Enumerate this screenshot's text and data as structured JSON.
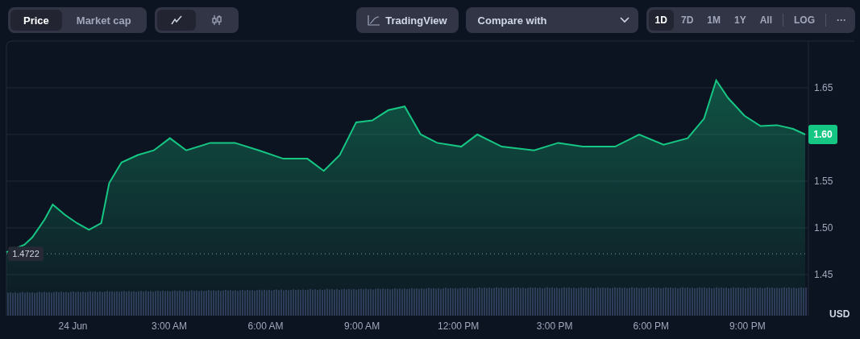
{
  "metric_tabs": [
    {
      "label": "Price",
      "selected": true
    },
    {
      "label": "Market cap",
      "selected": false
    }
  ],
  "style_tabs": [
    {
      "kind": "line",
      "selected": true
    },
    {
      "kind": "candles",
      "selected": false
    }
  ],
  "tradingview_button": "TradingView",
  "compare": {
    "placeholder": "Compare with"
  },
  "ranges": [
    {
      "label": "1D",
      "selected": true
    },
    {
      "label": "7D",
      "selected": false
    },
    {
      "label": "1M",
      "selected": false
    },
    {
      "label": "1Y",
      "selected": false
    },
    {
      "label": "All",
      "selected": false
    }
  ],
  "log_button": "LOG",
  "more_button": "···",
  "chart": {
    "start_price_label": "1.4722",
    "current_price_label": "1.60",
    "currency": "USD",
    "chart_data": {
      "type": "area",
      "x": [
        -2.07,
        -1.51,
        -1.26,
        -0.88,
        -0.63,
        -0.25,
        0.13,
        0.5,
        0.88,
        1.13,
        1.51,
        2.02,
        2.52,
        3.02,
        3.53,
        4.28,
        5.04,
        5.79,
        6.55,
        7.3,
        7.81,
        8.31,
        8.82,
        9.32,
        9.82,
        10.33,
        10.83,
        11.34,
        12.09,
        12.59,
        13.35,
        14.36,
        15.11,
        15.87,
        16.88,
        17.63,
        18.39,
        19.14,
        19.65,
        20.03,
        20.4,
        20.91,
        21.41,
        21.92,
        22.42,
        22.8
      ],
      "series": [
        {
          "color": "#16c784",
          "values": [
            1.474,
            1.482,
            1.49,
            1.509,
            1.525,
            1.514,
            1.505,
            1.498,
            1.505,
            1.548,
            1.57,
            1.578,
            1.583,
            1.596,
            1.583,
            1.591,
            1.591,
            1.583,
            1.574,
            1.574,
            1.561,
            1.578,
            1.613,
            1.615,
            1.626,
            1.63,
            1.6,
            1.591,
            1.587,
            1.6,
            1.587,
            1.583,
            1.591,
            1.587,
            1.587,
            1.6,
            1.589,
            1.596,
            1.617,
            1.658,
            1.639,
            1.62,
            1.609,
            1.61,
            1.606,
            1.6
          ]
        }
      ],
      "xlim": [
        -2.07,
        22.9
      ],
      "ylim": [
        1.406,
        1.7
      ],
      "grid": true,
      "ref_lines": [
        {
          "axis": "y",
          "value": 1.4722
        }
      ],
      "xticks": [
        {
          "value": 0,
          "label": "24 Jun"
        },
        {
          "value": 3,
          "label": "3:00 AM"
        },
        {
          "value": 6,
          "label": "6:00 AM"
        },
        {
          "value": 9,
          "label": "9:00 AM"
        },
        {
          "value": 12,
          "label": "12:00 PM"
        },
        {
          "value": 15,
          "label": "3:00 PM"
        },
        {
          "value": 18,
          "label": "6:00 PM"
        },
        {
          "value": 21,
          "label": "9:00 PM"
        }
      ],
      "yticks": [
        {
          "value": 1.45,
          "label": "1.45"
        },
        {
          "value": 1.5,
          "label": "1.50"
        },
        {
          "value": 1.55,
          "label": "1.55"
        },
        {
          "value": 1.65,
          "label": "1.65"
        }
      ]
    }
  }
}
